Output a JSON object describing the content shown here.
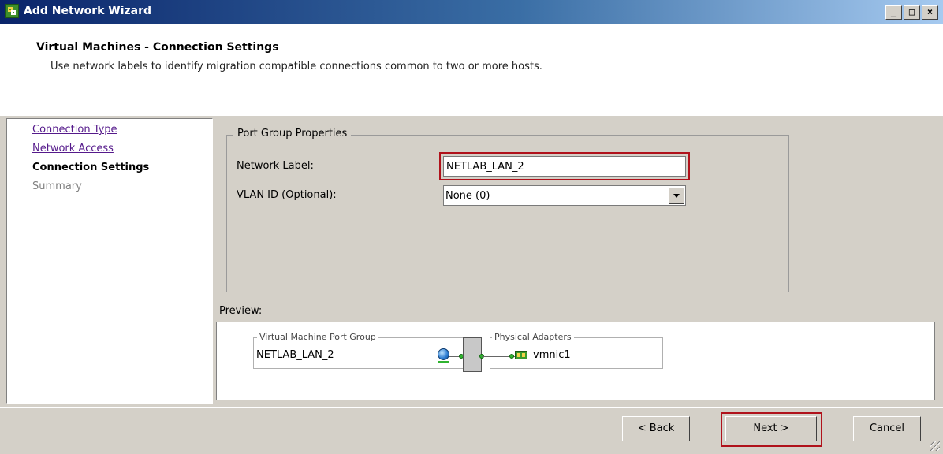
{
  "window": {
    "title": "Add Network Wizard",
    "controls": [
      "_",
      "□",
      "×"
    ]
  },
  "header": {
    "title": "Virtual Machines - Connection Settings",
    "subtitle": "Use network labels to identify migration compatible connections common to two or more hosts."
  },
  "nav": {
    "items": [
      {
        "label": "Connection Type",
        "state": "link"
      },
      {
        "label": "Network Access",
        "state": "link"
      },
      {
        "label": "Connection Settings",
        "state": "current"
      },
      {
        "label": "Summary",
        "state": "disabled"
      }
    ]
  },
  "port_group": {
    "legend": "Port Group Properties",
    "network_label": {
      "label": "Network Label:",
      "value": "NETLAB_LAN_2"
    },
    "vlan_id": {
      "label": "VLAN ID (Optional):",
      "value": "None (0)"
    }
  },
  "preview": {
    "label": "Preview:",
    "vm_port_group": {
      "legend": "Virtual Machine Port Group",
      "name": "NETLAB_LAN_2"
    },
    "physical_adapters": {
      "legend": "Physical Adapters",
      "adapter": "vmnic1"
    }
  },
  "buttons": {
    "back": "< Back",
    "next": "Next >",
    "cancel": "Cancel"
  },
  "colors": {
    "titlebar_start": "#0a246a",
    "highlight": "#b0121b",
    "panel_bg": "#d4d0c8",
    "visited_link": "#551a8b"
  },
  "icons": [
    "wizard-icon",
    "globe-icon",
    "network-adapter-icon",
    "dropdown-arrow-icon",
    "resize-grip-icon"
  ]
}
